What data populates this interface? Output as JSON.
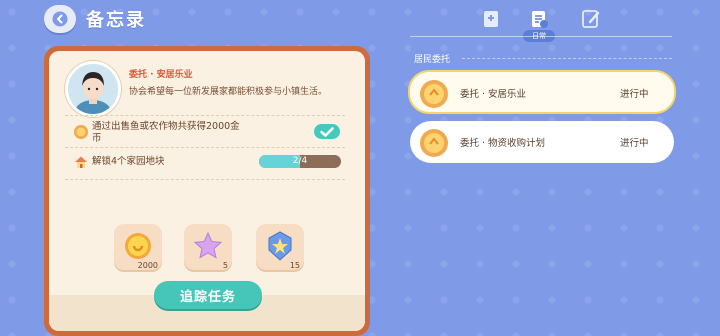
{
  "header": {
    "back_label": "",
    "title": "备忘录"
  },
  "quest": {
    "name": "委托 · 安居乐业",
    "description": "协会希望每一位新发展家都能积极参与小镇生活。",
    "requirements": [
      {
        "icon": "coin-icon",
        "text_line1": "通过出售鱼或农作物共获得2000金",
        "text_line2": "币",
        "completed": true
      },
      {
        "icon": "house-icon",
        "text": "解锁4个家园地块",
        "progress_text": "2/4",
        "progress": 0.5
      }
    ],
    "rewards": [
      {
        "icon": "gold-coin-icon",
        "count": "2000"
      },
      {
        "icon": "star-icon",
        "count": "5"
      },
      {
        "icon": "badge-icon",
        "count": "15"
      }
    ],
    "track_button": "追踪任务"
  },
  "tabs": {
    "active_label": "日常",
    "items": [
      "book-icon",
      "notes-icon",
      "edit-icon"
    ]
  },
  "commissions": {
    "section_title": "居民委托",
    "items": [
      {
        "title": "委托 · 安居乐业",
        "status": "进行中",
        "selected": true
      },
      {
        "title": "委托 · 物资收购计划",
        "status": "进行中",
        "selected": false
      }
    ]
  },
  "colors": {
    "background": "#7f9be8",
    "card_frame": "#cf6a3a",
    "card": "#fbf1e3",
    "accent_teal": "#45c6b8",
    "quest_red": "#e0553a"
  }
}
